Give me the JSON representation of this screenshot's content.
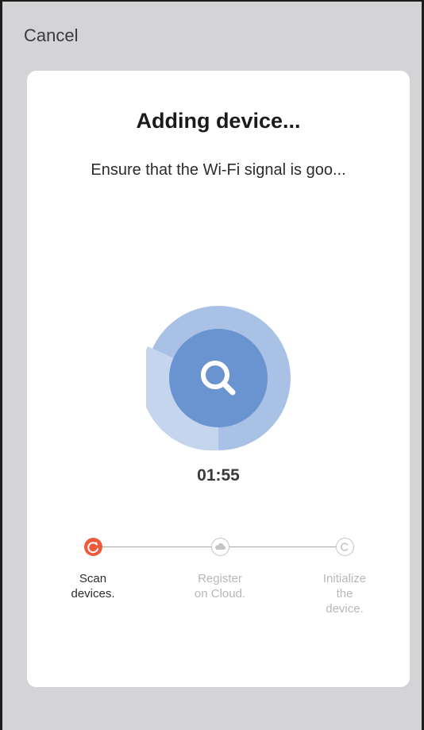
{
  "nav": {
    "cancel_label": "Cancel"
  },
  "card": {
    "title": "Adding device...",
    "subtitle": "Ensure that the Wi-Fi signal is goo...",
    "timer": "01:55",
    "scan_icon": "search-icon"
  },
  "steps": [
    {
      "line1": "Scan",
      "line2": "devices.",
      "line3": "",
      "state": "active",
      "icon": "refresh-icon"
    },
    {
      "line1": "Register",
      "line2": "on Cloud.",
      "line3": "",
      "state": "inactive",
      "icon": "cloud-icon"
    },
    {
      "line1": "Initialize",
      "line2": "the",
      "line3": "device.",
      "state": "inactive",
      "icon": "copyright-c-icon"
    }
  ],
  "colors": {
    "background": "#d4d4d6",
    "card": "#ffffff",
    "accent": "#ee5a3c",
    "scanner_inner": "#6a94d0",
    "scanner_outer": "#a9c1e4"
  }
}
